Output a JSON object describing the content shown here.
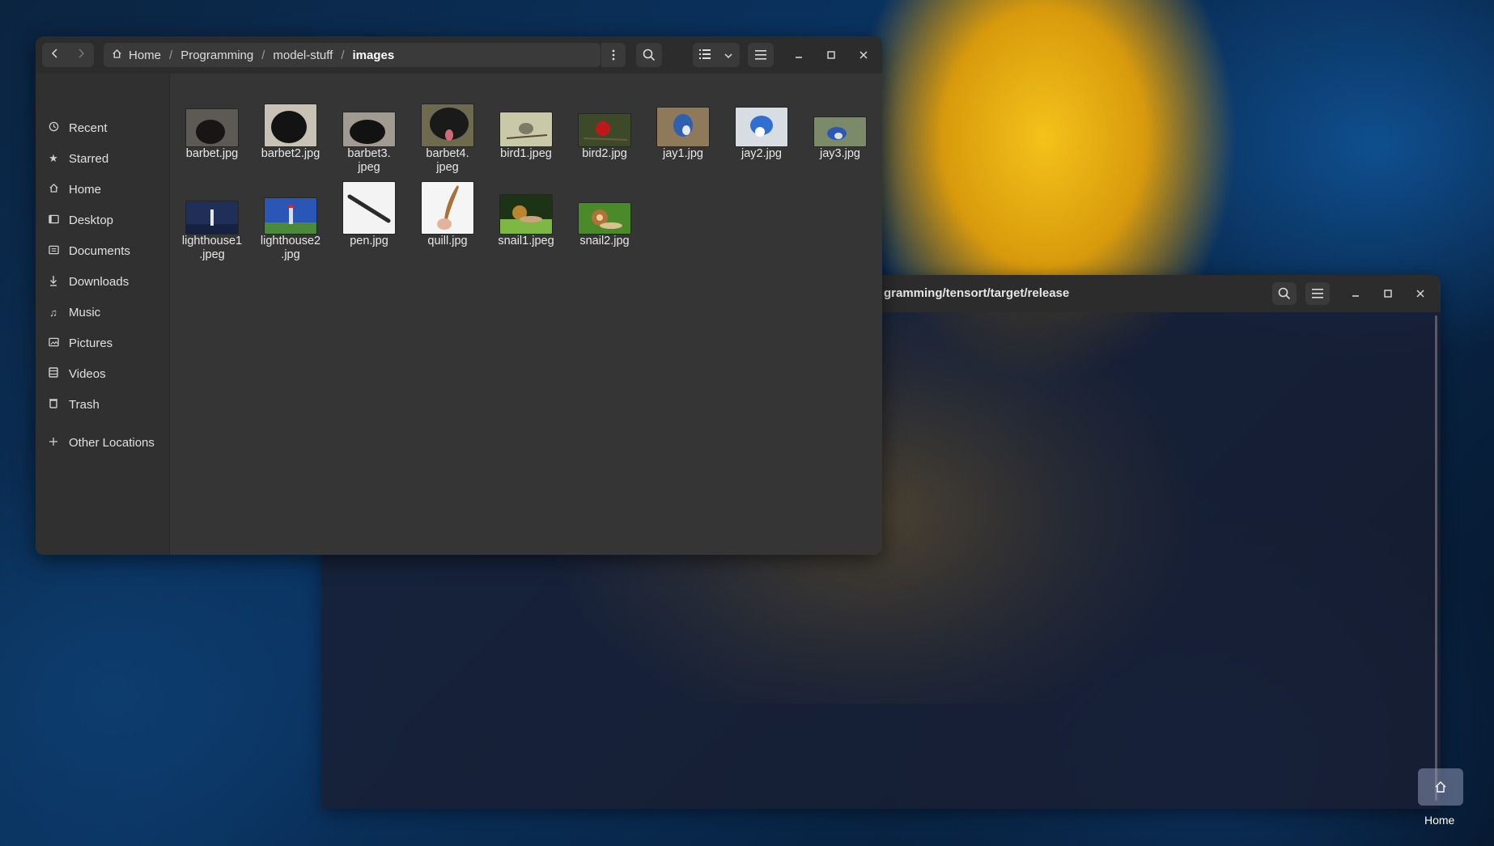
{
  "terminal": {
    "title": "gramming/tensort/target/release",
    "dock_label": "Home"
  },
  "file_manager": {
    "breadcrumb": [
      "Home",
      "Programming",
      "model-stuff",
      "images"
    ],
    "sidebar": [
      {
        "label": "Recent",
        "icon": "clock-icon"
      },
      {
        "label": "Starred",
        "icon": "star-icon"
      },
      {
        "label": "Home",
        "icon": "home-icon"
      },
      {
        "label": "Desktop",
        "icon": "desktop-icon"
      },
      {
        "label": "Documents",
        "icon": "document-icon"
      },
      {
        "label": "Downloads",
        "icon": "download-icon"
      },
      {
        "label": "Music",
        "icon": "music-icon"
      },
      {
        "label": "Pictures",
        "icon": "picture-icon"
      },
      {
        "label": "Videos",
        "icon": "video-icon"
      },
      {
        "label": "Trash",
        "icon": "trash-icon"
      },
      {
        "label": "Other Locations",
        "icon": "plus-icon"
      }
    ],
    "files": [
      {
        "name": "barbet.jpg",
        "colors": [
          "#5d5a55",
          "#171515"
        ]
      },
      {
        "name": "barbet2.jpg",
        "colors": [
          "#c8c2b5",
          "#131313"
        ]
      },
      {
        "name": "barbet3.\njpeg",
        "colors": [
          "#a09a90",
          "#121212"
        ]
      },
      {
        "name": "barbet4.\njpeg",
        "colors": [
          "#6d6a50",
          "#1a1a1a"
        ]
      },
      {
        "name": "bird1.jpeg",
        "colors": [
          "#c9c8a8",
          "#7b7b66"
        ]
      },
      {
        "name": "bird2.jpg",
        "colors": [
          "#3c4a2a",
          "#c0171a"
        ]
      },
      {
        "name": "jay1.jpg",
        "colors": [
          "#8e7a5a",
          "#2f5fb0"
        ]
      },
      {
        "name": "jay2.jpg",
        "colors": [
          "#d8dde4",
          "#2f6fd0"
        ]
      },
      {
        "name": "jay3.jpg",
        "colors": [
          "#7b8a68",
          "#2b58b8"
        ]
      },
      {
        "name": "lighthouse1\n.jpeg",
        "colors": [
          "#1f2f58",
          "#e6e6e6"
        ]
      },
      {
        "name": "lighthouse2\n.jpg",
        "colors": [
          "#2a56b8",
          "#dedede"
        ]
      },
      {
        "name": "pen.jpg",
        "colors": [
          "#f3f3f3",
          "#2a2a2a"
        ]
      },
      {
        "name": "quill.jpg",
        "colors": [
          "#f5f5f5",
          "#a8713a"
        ]
      },
      {
        "name": "snail1.jpeg",
        "colors": [
          "#1d3316",
          "#7db844"
        ]
      },
      {
        "name": "snail2.jpg",
        "colors": [
          "#4a8a2a",
          "#b07238"
        ]
      }
    ]
  }
}
